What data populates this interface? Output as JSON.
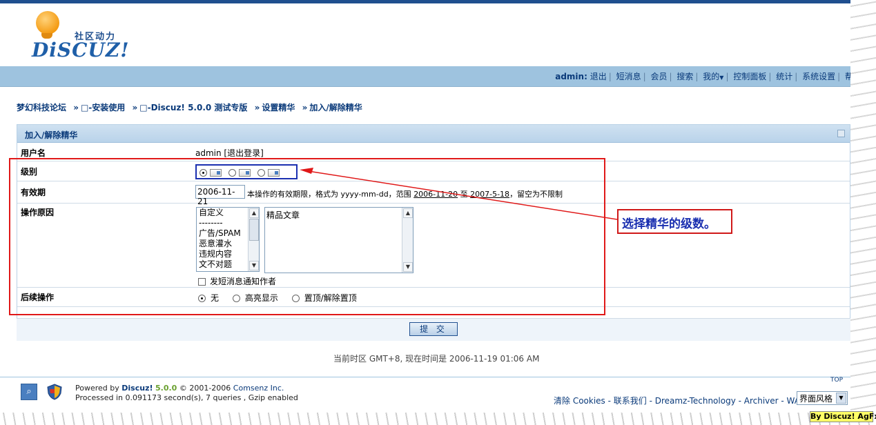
{
  "header": {
    "logo_cn": "社区动力",
    "logo_en": "DiSCUZ!"
  },
  "nav": {
    "user": "admin:",
    "items": [
      "退出",
      "短消息",
      "会员",
      "搜索",
      "我的",
      "控制面板",
      "统计",
      "系统设置",
      "帮助"
    ]
  },
  "breadcrumb": [
    "梦幻科技论坛",
    "□-安装使用",
    "□-Discuz! 5.0.0 测试专版",
    "设置精华",
    "加入/解除精华"
  ],
  "form": {
    "title": "加入/解除精华",
    "username_label": "用户名",
    "username_value": "admin [退出登录]",
    "level_label": "级别",
    "levels_selected_index": 0,
    "expiry_label": "有效期",
    "expiry_value": "2006-11-21",
    "expiry_hint_prefix": "本操作的有效期限，格式为 yyyy-mm-dd，范围",
    "expiry_range_start": "2006-11-20",
    "expiry_range_to": "至",
    "expiry_range_end": "2007-5-18",
    "expiry_hint_suffix": "，留空为不限制",
    "reason_label": "操作原因",
    "reason_options": [
      "自定义",
      "--------",
      "广告/SPAM",
      "恶意灌水",
      "违规内容",
      "文不对题"
    ],
    "reason_text": "精品文章",
    "notify_label": "发短消息通知作者",
    "followup_label": "后续操作",
    "followup_options": [
      "无",
      "高亮显示",
      "置顶/解除置顶"
    ],
    "followup_selected_index": 0,
    "submit_label": "提 交"
  },
  "annotation": {
    "callout_text": "选择精华的级数。",
    "colors": {
      "box": "#e01818",
      "text": "#1a2fb0"
    }
  },
  "footer": {
    "timezone": "当前时区 GMT+8, 现在时间是 2006-11-19 01:06 AM",
    "powered_prefix": "Powered by",
    "powered_brand": "Discuz!",
    "powered_version": "5.0.0",
    "copyright_prefix": "© 2001-2006",
    "copyright_company": "Comsenz Inc.",
    "processed": "Processed in 0.091173 second(s), 7 queries , Gzip enabled",
    "top": "TOP",
    "links": "清除 Cookies - 联系我们 - Dreamz-Technology - Archiver - WAP",
    "style_select": "界面风格",
    "watermark": "By Discuz! AgFx"
  },
  "colors": {
    "nav_bg": "#9ec3df",
    "link": "#0a3a7a",
    "panel_head": "#b9d3ea"
  }
}
